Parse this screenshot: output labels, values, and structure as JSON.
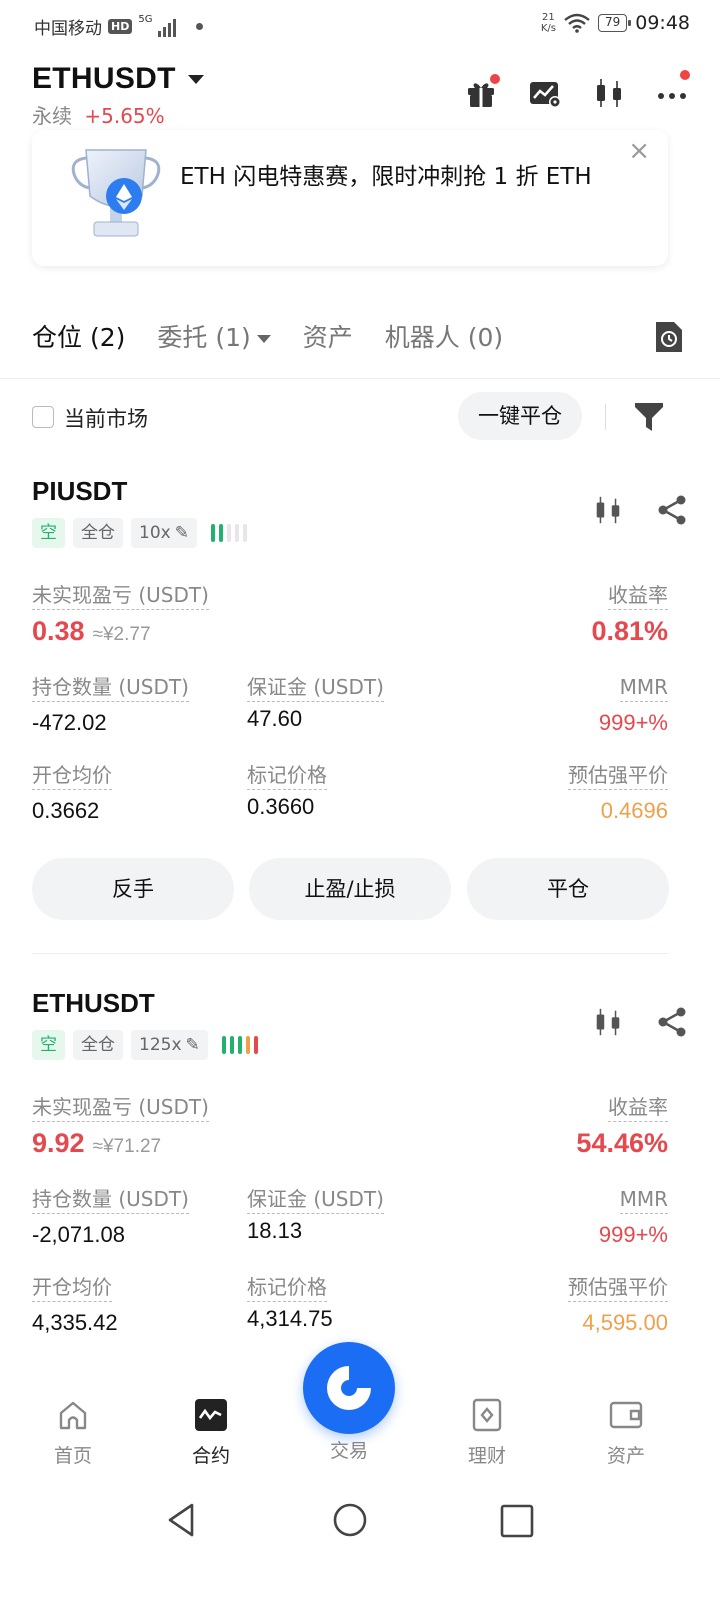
{
  "status_bar": {
    "carrier": "中国移动",
    "hd": "HD",
    "network": "5G",
    "net_speed_value": "21",
    "net_speed_unit": "K/s",
    "battery": "79",
    "time": "09:48"
  },
  "header": {
    "symbol": "ETHUSDT",
    "contract_type": "永续",
    "change": "+5.65%"
  },
  "banner": {
    "text": "ETH 闪电特惠赛，限时冲刺抢 1 折 ETH",
    "close_glyph": "×"
  },
  "tabs": [
    {
      "label": "仓位 (2)"
    },
    {
      "label": "委托 (1)"
    },
    {
      "label": "资产"
    },
    {
      "label": "机器人 (0)"
    }
  ],
  "filter": {
    "current_market_label": "当前市场",
    "close_all_label": "一键平仓"
  },
  "labels": {
    "unrealized_pnl": "未实现盈亏 (USDT)",
    "roe": "收益率",
    "position_size": "持仓数量 (USDT)",
    "margin": "保证金 (USDT)",
    "mmr": "MMR",
    "entry_price": "开仓均价",
    "mark_price": "标记价格",
    "liq_price": "预估强平价"
  },
  "positions": [
    {
      "symbol": "PIUSDT",
      "side": "空",
      "margin_mode": "全仓",
      "leverage": "10x",
      "pnl": "0.38",
      "pnl_cny": "≈¥2.77",
      "roe": "0.81%",
      "size": "-472.02",
      "margin": "47.60",
      "mmr": "999+%",
      "entry_price": "0.3662",
      "mark_price": "0.3660",
      "liq_price": "0.4696",
      "actions": [
        "反手",
        "止盈/止损",
        "平仓"
      ]
    },
    {
      "symbol": "ETHUSDT",
      "side": "空",
      "margin_mode": "全仓",
      "leverage": "125x",
      "pnl": "9.92",
      "pnl_cny": "≈¥71.27",
      "roe": "54.46%",
      "size": "-2,071.08",
      "margin": "18.13",
      "mmr": "999+%",
      "entry_price": "4,335.42",
      "mark_price": "4,314.75",
      "liq_price": "4,595.00"
    }
  ],
  "bottom_nav": [
    {
      "label": "首页",
      "icon": "home-icon"
    },
    {
      "label": "合约",
      "icon": "futures-icon"
    },
    {
      "label": "交易",
      "icon": "trade-icon"
    },
    {
      "label": "理财",
      "icon": "earn-icon"
    },
    {
      "label": "资产",
      "icon": "wallet-icon"
    }
  ],
  "colors": {
    "red": "#e5484d",
    "green": "#23b26d",
    "orange": "#f0a04b",
    "brand_blue": "#1b6ef3"
  }
}
